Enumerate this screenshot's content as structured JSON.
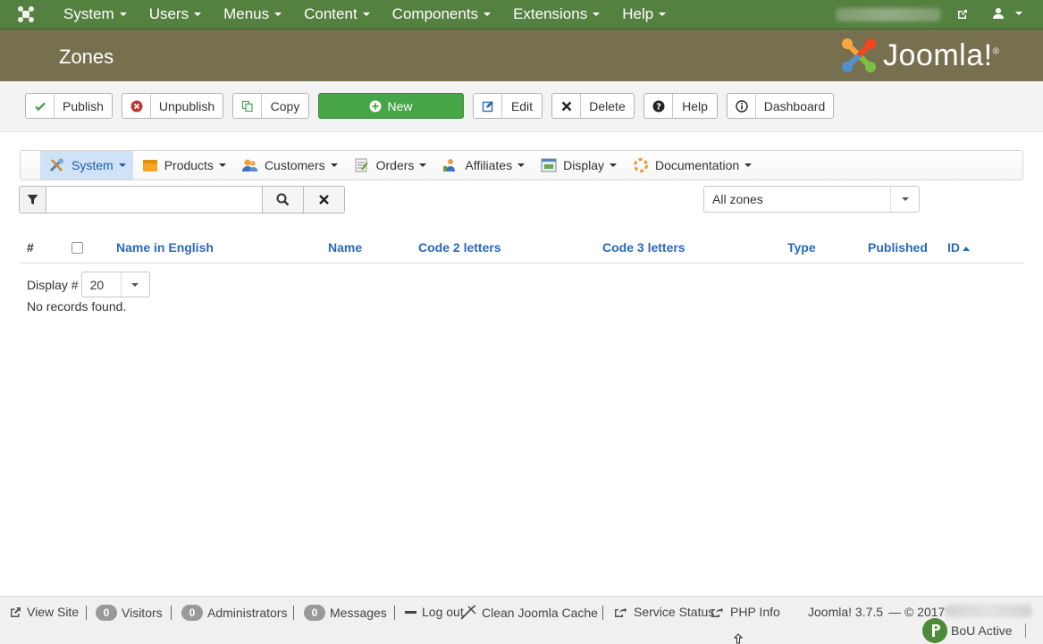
{
  "topnav": {
    "menu": [
      {
        "label": "System",
        "name": "topnav-system"
      },
      {
        "label": "Users",
        "name": "topnav-users"
      },
      {
        "label": "Menus",
        "name": "topnav-menus"
      },
      {
        "label": "Content",
        "name": "topnav-content"
      },
      {
        "label": "Components",
        "name": "topnav-components"
      },
      {
        "label": "Extensions",
        "name": "topnav-extensions"
      },
      {
        "label": "Help",
        "name": "topnav-help"
      }
    ]
  },
  "header": {
    "title": "Zones",
    "brand": "Joomla!"
  },
  "toolbar": {
    "publish": "Publish",
    "unpublish": "Unpublish",
    "copy": "Copy",
    "new": "New",
    "edit": "Edit",
    "delete": "Delete",
    "help": "Help",
    "dashboard": "Dashboard"
  },
  "component_menu": {
    "system": "System",
    "products": "Products",
    "customers": "Customers",
    "orders": "Orders",
    "affiliates": "Affiliates",
    "display": "Display",
    "documentation": "Documentation"
  },
  "filters": {
    "search_value": "",
    "zone_filter": "All zones"
  },
  "table": {
    "headers": {
      "num": "#",
      "name_english": "Name in English",
      "name": "Name",
      "code2": "Code 2 letters",
      "code3": "Code 3 letters",
      "type": "Type",
      "published": "Published",
      "id": "ID"
    },
    "display_label": "Display #",
    "limit": "20",
    "empty_message": "No records found."
  },
  "statusbar": {
    "view_site": "View Site",
    "visitors_count": "0",
    "visitors": "Visitors",
    "admins_count": "0",
    "admins": "Administrators",
    "messages_count": "0",
    "messages": "Messages",
    "logout": "Log out",
    "clean_cache": "Clean Joomla Cache",
    "service_status": "Service Status",
    "php_info": "PHP Info",
    "version": "Joomla! 3.7.5",
    "copyright": "— © 2017",
    "bou_status": "BoU Active"
  },
  "colors": {
    "topnav": "#558140",
    "header": "#77704e",
    "new_button": "#46a546",
    "link": "#2a69b8"
  }
}
